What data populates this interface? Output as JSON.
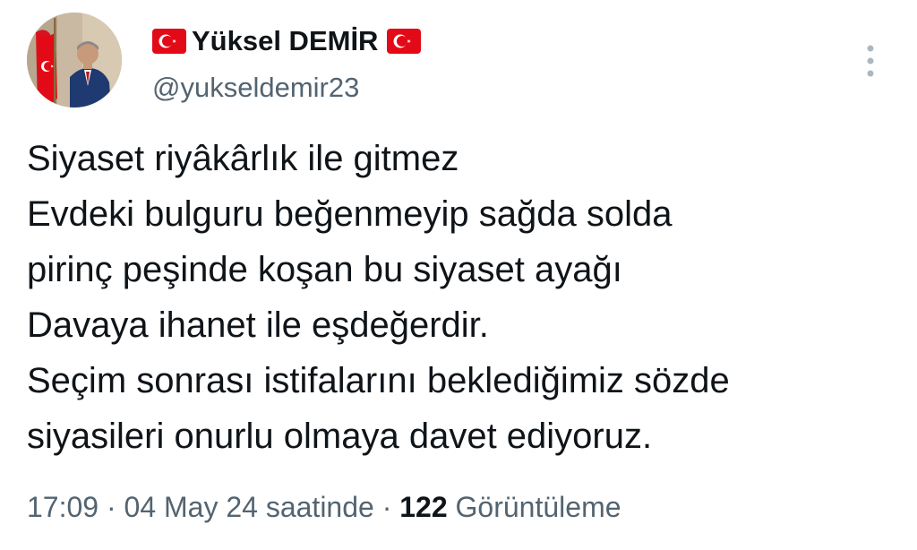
{
  "user": {
    "display_name": "Yüksel DEMİR",
    "handle": "@yukseldemir23",
    "avatar_icon": "profile-photo-avatar",
    "flag_icon": "turkish-flag-emoji"
  },
  "menu": {
    "more_icon": "vertical-ellipsis-icon"
  },
  "tweet": {
    "lines": [
      "Siyaset riyâkârlık ile gitmez",
      "Evdeki bulguru beğenmeyip sağda solda",
      "pirinç peşinde koşan bu siyaset ayağı",
      "Davaya ihanet ile eşdeğerdir.",
      "Seçim sonrası istifalarını beklediğimiz sözde",
      "siyasileri onurlu olmaya davet ediyoruz."
    ]
  },
  "meta": {
    "time": "17:09",
    "separator": " · ",
    "date": "04 May 24 saatinde",
    "views_count": "122",
    "views_label": "Görüntüleme"
  },
  "colors": {
    "text_primary": "#0f1419",
    "text_secondary": "#536471",
    "flag_red": "#e30a17",
    "background": "#ffffff"
  }
}
